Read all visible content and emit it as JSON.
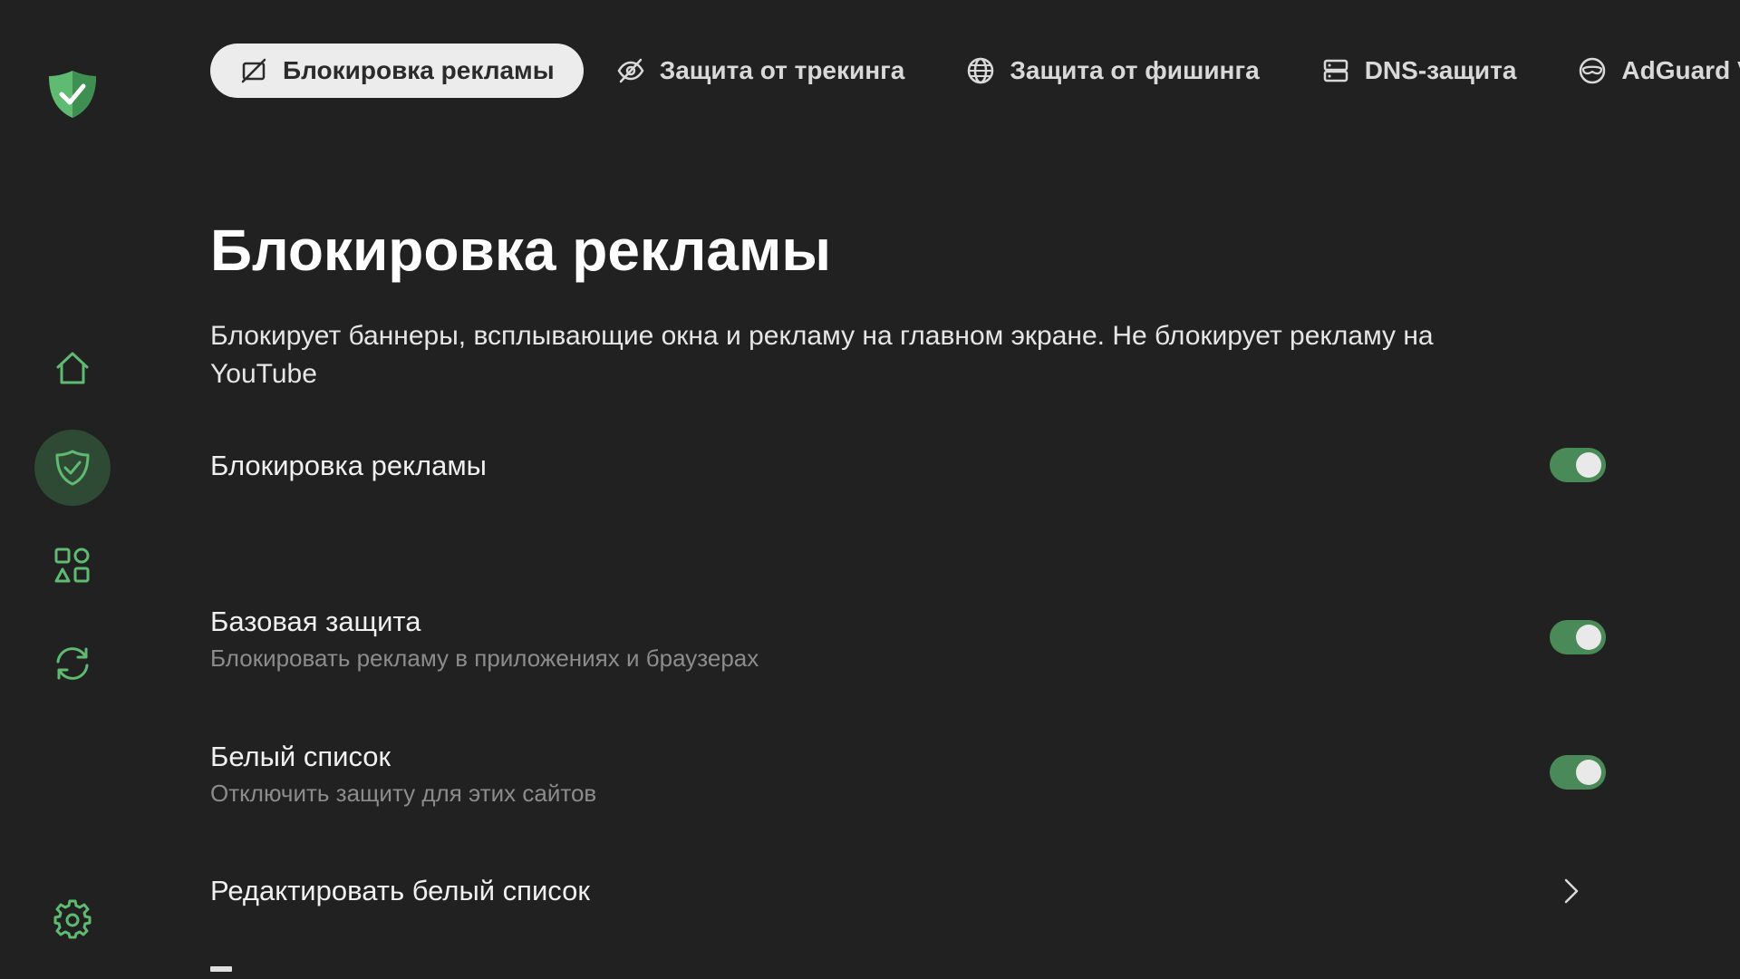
{
  "colors": {
    "background": "#212121",
    "accent": "#5fba72",
    "active_nav": "#2e4a34",
    "toggle_on": "#4a8a58",
    "active_tab_bg": "#ececec"
  },
  "sidebar": {
    "logo_icon": "shield-check-logo",
    "items": [
      {
        "icon": "home-icon",
        "active": false
      },
      {
        "icon": "shield-icon",
        "active": true
      },
      {
        "icon": "apps-grid-icon",
        "active": false
      },
      {
        "icon": "sync-icon",
        "active": false
      },
      {
        "icon": "gear-icon",
        "active": false
      }
    ]
  },
  "tabs": [
    {
      "label": "Блокировка рекламы",
      "icon": "ad-block-icon",
      "active": true
    },
    {
      "label": "Защита от трекинга",
      "icon": "eye-off-icon",
      "active": false
    },
    {
      "label": "Защита от фишинга",
      "icon": "globe-icon",
      "active": false
    },
    {
      "label": "DNS-защита",
      "icon": "server-icon",
      "active": false
    },
    {
      "label": "AdGuard VPN",
      "icon": "vpn-icon",
      "active": false
    }
  ],
  "page": {
    "title": "Блокировка рекламы",
    "description": "Блокирует баннеры, всплывающие окна и рекламу на главном экране. Не блокирует рекламу на YouTube"
  },
  "settings": {
    "ad_blocking": {
      "title": "Блокировка рекламы",
      "enabled": true
    },
    "basic_protection": {
      "title": "Базовая защита",
      "subtitle": "Блокировать рекламу в приложениях и браузерах",
      "enabled": true
    },
    "allowlist": {
      "title": "Белый список",
      "subtitle": "Отключить защиту для этих сайтов",
      "enabled": true
    },
    "edit_allowlist": {
      "title": "Редактировать белый список"
    }
  }
}
